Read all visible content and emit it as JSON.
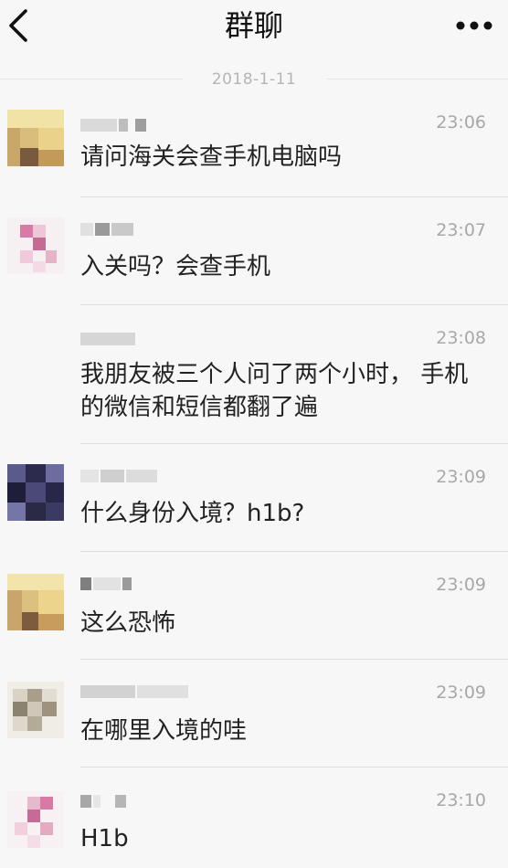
{
  "header": {
    "title": "群聊",
    "back_icon": "chevron-left-icon",
    "more_icon": "more-dots-icon"
  },
  "date_separator": "2018-1-11",
  "messages": [
    {
      "time": "23:06",
      "text": "请问海关会查手机电脑吗"
    },
    {
      "time": "23:07",
      "text": "入关吗？会查手机"
    },
    {
      "time": "23:08",
      "text": "我朋友被三个人问了两个小时， 手机的微信和短信都翻了遍"
    },
    {
      "time": "23:09",
      "text": "什么身份入境？h1b?"
    },
    {
      "time": "23:09",
      "text": "这么恐怖"
    },
    {
      "time": "23:09",
      "text": "在哪里入境的哇"
    },
    {
      "time": "23:10",
      "text": "H1b"
    }
  ]
}
